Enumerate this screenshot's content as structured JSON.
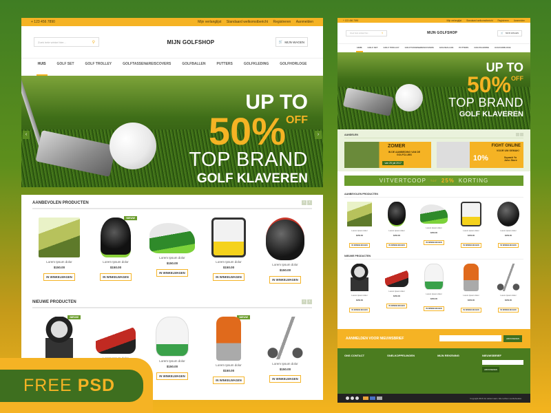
{
  "colors": {
    "accent": "#f5b324",
    "green": "#3e6f1f"
  },
  "topbar": {
    "phone": "+ 123 456 7890",
    "links": [
      "Mijn verlanglijst",
      "Standaard welkomstbericht",
      "Registreren",
      "Aanmelden"
    ]
  },
  "header": {
    "search_placeholder": "Zoek hele winkel hier...",
    "logo": "MIJN GOLFSHOP",
    "cart": "MIJN WAGEN"
  },
  "nav": [
    "HUIS",
    "GOLF SET",
    "GOLF TROLLEY",
    "GOLFTASSEN&REISCOVERS",
    "GOLFBALLEN",
    "PUTTERS",
    "GOLFKLEDING",
    "GOLFHORLOGE"
  ],
  "hero": {
    "upto": "UP TO",
    "pct": "50%",
    "off": "OFF",
    "brand": "TOP BRAND",
    "sub": "GOLF KLAVEREN"
  },
  "sections": {
    "recommended": "AANBEVOLEN PRODUCTEN",
    "new": "NIEUWE PRODUCTEN",
    "deals": "AANDELEN",
    "newsletter": "AANMELDEN VOOR NIEUWSBRIEF",
    "subscribe": "ABONNEREN"
  },
  "products": {
    "name": "Lorem Ipsum dolor",
    "price": "$150.00",
    "button": "IN WINKELWAGEN",
    "badge": "NIEUW"
  },
  "banners": {
    "summer_title": "ZOMER",
    "summer_text": "IN DE AANBIEDING VAN DE GOLFCLUBS",
    "summer_date": "van 25 juli 2017",
    "fight_title": "FIGHT ONLINE",
    "fight_sub": "VOOR UW GEMAK!",
    "fight_pct": "10%",
    "fight_note": "Squash Yo John Store",
    "wide_left": "VITVERTCOOP",
    "wide_tot": "TOT",
    "wide_pct": "25%",
    "wide_right": "KORTING"
  },
  "footer": {
    "cols": [
      "ONS CONTACT",
      "SNELKOPPELINGEN",
      "MIJN REKENING",
      "NIEUWSBRIEF"
    ],
    "copyright": "Copyright 2016 Uw winkel naam. Alle rechten voorbehouden."
  },
  "badge": {
    "free": "FREE",
    "psd": "PSD"
  }
}
